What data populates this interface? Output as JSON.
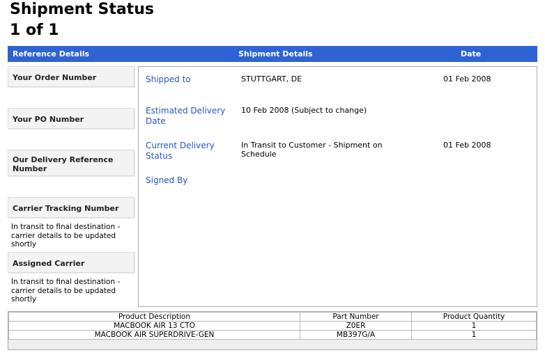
{
  "page": {
    "title": "Shipment Status",
    "pager": "1 of 1"
  },
  "header": {
    "reference": "Reference Details",
    "shipment": "Shipment Details",
    "date": "Date"
  },
  "reference": {
    "order_number": "Your Order Number",
    "po_number": "Your PO Number",
    "delivery_reference": "Our Delivery Reference Number",
    "carrier_tracking": "Carrier Tracking Number",
    "carrier_tracking_value": "In transit to final destination - carrier details to be updated shortly",
    "assigned_carrier": "Assigned Carrier",
    "assigned_carrier_value": "In transit to final destination - carrier details to be updated shortly"
  },
  "details": {
    "shipped_to_label": "Shipped to",
    "shipped_to_value": "STUTTGART, DE",
    "shipped_to_date": "01 Feb 2008",
    "estimated_label": "Estimated Delivery Date",
    "estimated_value": "10 Feb 2008 (Subject to change)",
    "current_label": "Current Delivery Status",
    "current_value": "In Transit to Customer - Shipment on Schedule",
    "current_date": "01 Feb 2008",
    "signed_label": "Signed By"
  },
  "products": {
    "headers": [
      "Product Description",
      "Part Number",
      "Product Quantity"
    ],
    "rows": [
      [
        "MACBOOK AIR 13 CTO",
        "Z0ER",
        "1"
      ],
      [
        "MACBOOK AIR SUPERDRIVE-GEN",
        "MB397G/A",
        "1"
      ]
    ]
  }
}
